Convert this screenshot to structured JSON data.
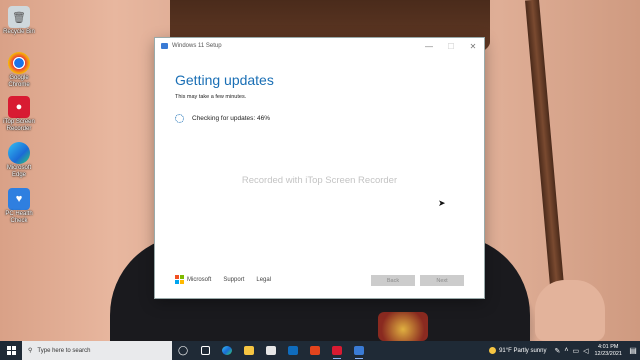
{
  "desktop": {
    "icons": [
      {
        "label": "Recycle Bin",
        "icon": "recycle-bin-icon",
        "color": "#cfd8dc"
      },
      {
        "label": "Google Chrome",
        "icon": "chrome-icon",
        "color": "#e94235"
      },
      {
        "label": "iTop Screen Recorder",
        "icon": "screen-recorder-icon",
        "color": "#d81b32"
      },
      {
        "label": "Microsoft Edge",
        "icon": "edge-icon",
        "color": "#1b9bd6"
      },
      {
        "label": "PC Health Check",
        "icon": "pc-health-icon",
        "color": "#2f7fe0"
      }
    ]
  },
  "window": {
    "title": "Windows 11 Setup",
    "heading": "Getting updates",
    "subheading": "This may take a few minutes.",
    "status": "Checking for updates: 46%",
    "progress_percent": 46,
    "watermark": "Recorded with iTop Screen Recorder",
    "footer": {
      "brand": "Microsoft",
      "support": "Support",
      "legal": "Legal"
    },
    "buttons": {
      "back": "Back",
      "next": "Next"
    },
    "controls": {
      "minimize": "—",
      "maximize": "☐",
      "close": "✕"
    },
    "accent": "#1a6fb5"
  },
  "taskbar": {
    "search_placeholder": "Type here to search",
    "apps": [
      "task-view-icon",
      "widgets-icon",
      "edge-icon",
      "file-explorer-icon",
      "store-icon",
      "mail-icon",
      "office-icon",
      "screen-recorder-icon",
      "setup-icon"
    ],
    "weather": "91°F  Partly sunny",
    "time": "4:01 PM",
    "date": "12/23/2021"
  }
}
